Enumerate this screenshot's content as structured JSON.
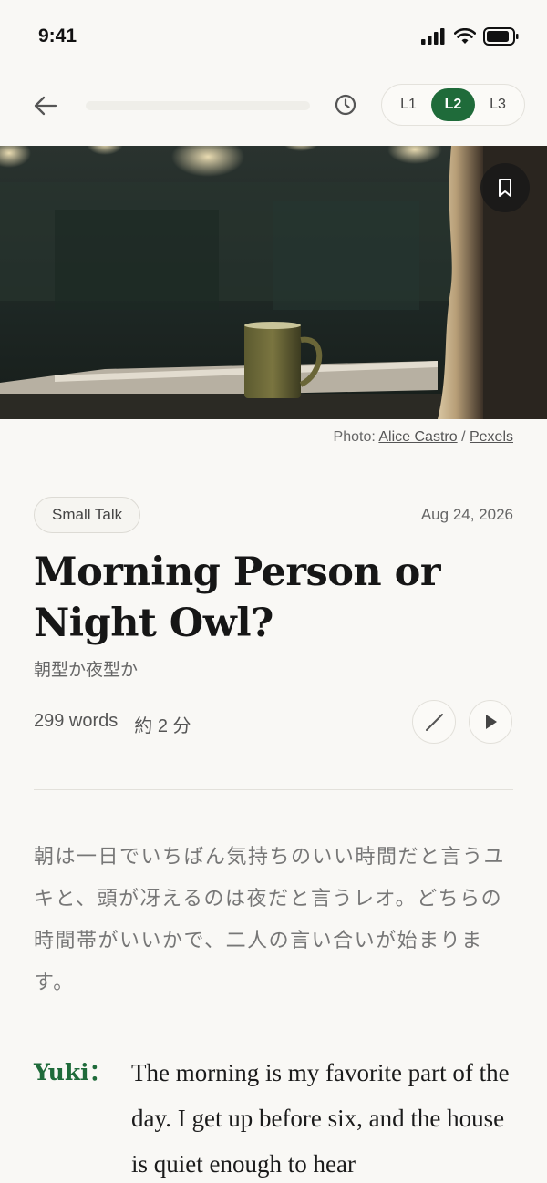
{
  "status_bar": {
    "time": "9:41"
  },
  "nav": {
    "reading_progress": 0.0,
    "levels": [
      {
        "label": "L1",
        "active": false
      },
      {
        "label": "L2",
        "active": true
      },
      {
        "label": "L3",
        "active": false
      }
    ]
  },
  "hero": {
    "credit_prefix": "Photo: ",
    "photographer": "Alice Castro",
    "separator": " / ",
    "source": "Pexels"
  },
  "article": {
    "category": "Small Talk",
    "date": "Aug 24, 2026",
    "title": "Morning Person or Night Owl?",
    "subtitle_ja": "朝型か夜型か",
    "word_count": "299 words",
    "read_time": "約 2 分",
    "intro_ja": "朝は一日でいちばん気持ちのいい時間だと言うユキと、頭が冴えるのは夜だと言うレオ。どちらの時間帯がいいかで、二人の言い合いが始まります。",
    "dialogue": [
      {
        "speaker": "Yuki：",
        "text": "The morning is my favorite part of the day. I get up before six, and the house is quiet enough to hear"
      }
    ]
  },
  "colors": {
    "accent": "#1f6b3a",
    "background": "#f9f8f5"
  },
  "icons": [
    "back-arrow-icon",
    "history-clock-icon",
    "bookmark-icon",
    "pencil-slash-icon",
    "play-icon"
  ]
}
